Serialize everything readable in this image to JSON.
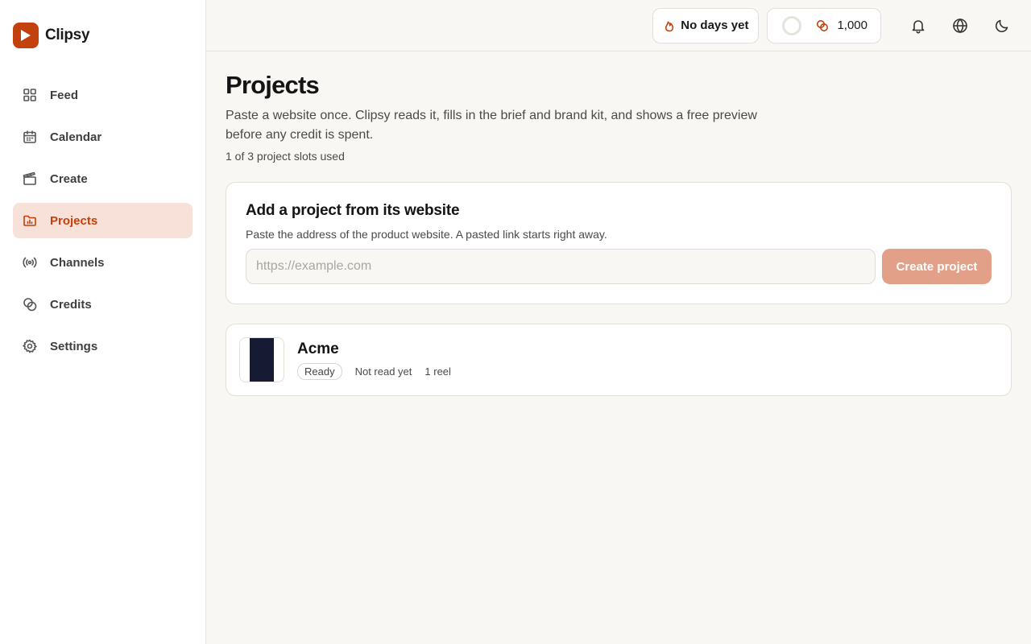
{
  "brand": {
    "name": "Clipsy",
    "accent": "#c2410c"
  },
  "sidebar": {
    "items": [
      {
        "label": "Feed",
        "icon": "grid-icon",
        "active": false
      },
      {
        "label": "Calendar",
        "icon": "calendar-icon",
        "active": false
      },
      {
        "label": "Create",
        "icon": "clapperboard-icon",
        "active": false
      },
      {
        "label": "Projects",
        "icon": "folder-chart-icon",
        "active": true
      },
      {
        "label": "Channels",
        "icon": "broadcast-icon",
        "active": false
      },
      {
        "label": "Credits",
        "icon": "coins-icon",
        "active": false
      },
      {
        "label": "Settings",
        "icon": "gear-icon",
        "active": false
      }
    ]
  },
  "topbar": {
    "streak_label": "No days yet",
    "credits_value": "1,000",
    "icons": [
      "bell-icon",
      "globe-icon",
      "moon-icon"
    ]
  },
  "page": {
    "title": "Projects",
    "description": "Paste a website once. Clipsy reads it, fills in the brief and brand kit, and shows a free preview before any credit is spent.",
    "slots": "1 of 3 project slots used"
  },
  "add_project": {
    "title": "Add a project from its website",
    "help": "Paste the address of the product website. A pasted link starts right away.",
    "placeholder": "https://example.com",
    "value": "",
    "button_label": "Create project"
  },
  "projects": [
    {
      "name": "Acme",
      "status": "Ready",
      "read_state": "Not read yet",
      "reels": "1 reel"
    }
  ]
}
